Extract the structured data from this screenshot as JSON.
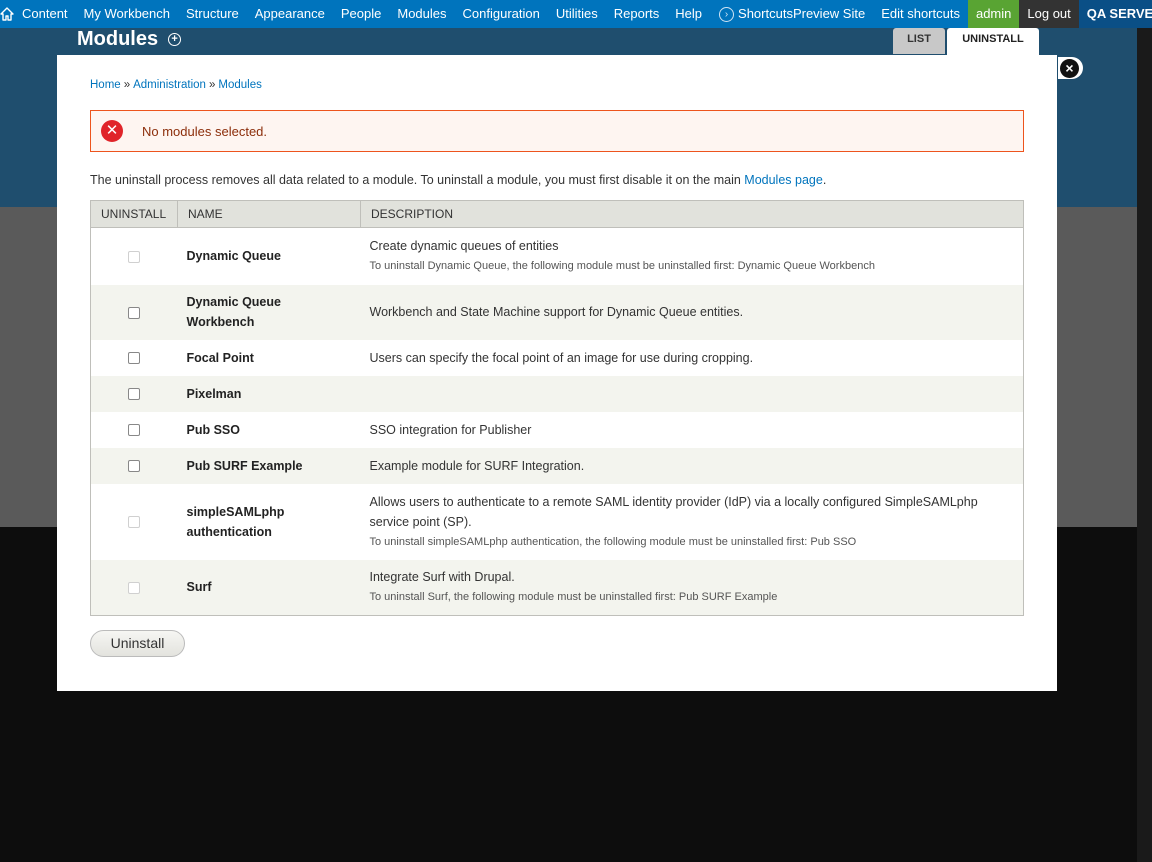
{
  "toolbar": {
    "items": [
      "Content",
      "My Workbench",
      "Structure",
      "Appearance",
      "People",
      "Modules",
      "Configuration",
      "Utilities",
      "Reports",
      "Help"
    ],
    "shortcuts_label": "Shortcuts",
    "preview_label": "Preview Site",
    "edit_shortcuts_label": "Edit shortcuts",
    "user_label": "admin",
    "logout_label": "Log out",
    "server_label": "QA SERVER"
  },
  "page": {
    "title": "Modules",
    "tabs": {
      "list": "LIST",
      "uninstall": "UNINSTALL"
    }
  },
  "overlay": {
    "breadcrumb": [
      "Home",
      "Administration",
      "Modules"
    ],
    "error_message": "No modules selected.",
    "intro_text": "The uninstall process removes all data related to a module. To uninstall a module, you must first disable it on the main ",
    "intro_link": "Modules page",
    "intro_end": ".",
    "table": {
      "headers": [
        "UNINSTALL",
        "NAME",
        "DESCRIPTION"
      ],
      "rows": [
        {
          "name": "Dynamic Queue",
          "desc": "Create dynamic queues of entities",
          "note": "To uninstall Dynamic Queue, the following module must be uninstalled first: Dynamic Queue Workbench",
          "disabled": true
        },
        {
          "name": "Dynamic Queue Workbench",
          "desc": "Workbench and State Machine support for Dynamic Queue entities.",
          "note": "",
          "disabled": false
        },
        {
          "name": "Focal Point",
          "desc": "Users can specify the focal point of an image for use during cropping.",
          "note": "",
          "disabled": false
        },
        {
          "name": "Pixelman",
          "desc": "",
          "note": "",
          "disabled": false
        },
        {
          "name": "Pub SSO",
          "desc": "SSO integration for Publisher",
          "note": "",
          "disabled": false
        },
        {
          "name": "Pub SURF Example",
          "desc": "Example module for SURF Integration.",
          "note": "",
          "disabled": false
        },
        {
          "name": "simpleSAMLphp authentication",
          "desc": "Allows users to authenticate to a remote SAML identity provider (IdP) via a locally configured SimpleSAMLphp service point (SP).",
          "note": "To uninstall simpleSAMLphp authentication, the following module must be uninstalled first: Pub SSO",
          "disabled": true
        },
        {
          "name": "Surf",
          "desc": "Integrate Surf with Drupal.",
          "note": "To uninstall Surf, the following module must be uninstalled first: Pub SURF Example",
          "disabled": true
        }
      ]
    },
    "uninstall_button": "Uninstall"
  }
}
